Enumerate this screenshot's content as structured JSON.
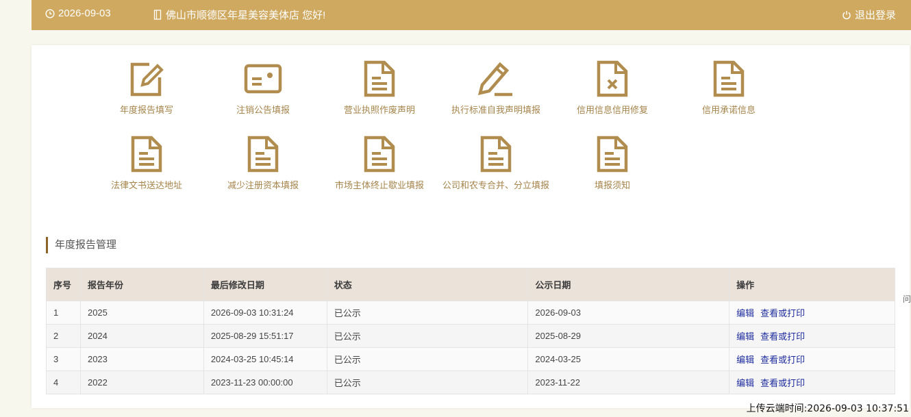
{
  "topbar": {
    "date": "2026-09-03",
    "greeting": "佛山市顺德区年星美容美体店 您好!",
    "logout_label": "退出登录"
  },
  "tiles": [
    {
      "label": "年度报告填写",
      "icon": "edit-icon"
    },
    {
      "label": "注销公告填报",
      "icon": "card-icon"
    },
    {
      "label": "营业执照作废声明",
      "icon": "document-icon"
    },
    {
      "label": "执行标准自我声明填报",
      "icon": "pencil-icon"
    },
    {
      "label": "信用信息信用修复",
      "icon": "document-x-icon"
    },
    {
      "label": "信用承诺信息",
      "icon": "document-icon"
    },
    {
      "label": "法律文书送达地址",
      "icon": "document-icon"
    },
    {
      "label": "减少注册资本填报",
      "icon": "document-icon"
    },
    {
      "label": "市场主体终止歇业填报",
      "icon": "document-icon"
    },
    {
      "label": "公司和农专合并、分立填报",
      "icon": "document-icon"
    },
    {
      "label": "填报须知",
      "icon": "document-icon"
    }
  ],
  "section": {
    "title": "年度报告管理"
  },
  "table": {
    "headers": [
      "序号",
      "报告年份",
      "最后修改日期",
      "状态",
      "公示日期",
      "操作"
    ],
    "rows": [
      [
        "1",
        "2025",
        "2026-09-03 10:31:24",
        "已公示",
        "2026-09-03"
      ],
      [
        "2",
        "2024",
        "2025-08-29 15:51:17",
        "已公示",
        "2025-08-29"
      ],
      [
        "3",
        "2023",
        "2024-03-25 10:45:14",
        "已公示",
        "2024-03-25"
      ],
      [
        "4",
        "2022",
        "2023-11-23 00:00:00",
        "已公示",
        "2023-11-22"
      ]
    ],
    "edit_label": "编辑",
    "print_label": "查看或打印"
  },
  "footer": {
    "upload_time": "上传云端时间:2026-09-03 10:37:51"
  },
  "edge_char": "问",
  "colors": {
    "header": "#cfa95f",
    "icon": "#b08d4f",
    "link": "#1f2d9e"
  }
}
